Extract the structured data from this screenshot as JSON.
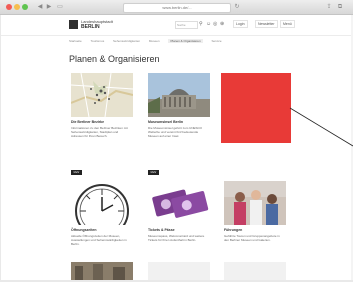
{
  "browser": {
    "address": "www.berlin.de/..."
  },
  "site": {
    "logo_line1": "Landeshauptstadt",
    "logo_line2": "BERLIN",
    "search_placeholder": "Suche",
    "header_links": [
      "Login",
      "Newsletter",
      "Menü"
    ]
  },
  "breadcrumb": [
    "Startseite",
    "Tourismus",
    "Sehenswürdigkeiten",
    "Museen",
    "Planen & Organisieren",
    "Service"
  ],
  "page": {
    "title": "Planen & Organisieren"
  },
  "cards": [
    {
      "title": "Die Berliner Bezirke",
      "text": "Informationen zu den Berliner Bezirken mit Sehenswürdigkeiten, Stadtplan und Adressen für Ihren Besuch.",
      "button": "Mehr"
    },
    {
      "title": "Museumsinsel Berlin",
      "text": "Die Museumsinsel gehört zum UNESCO Welterbe und vereint fünf bedeutende Museen auf einer Insel.",
      "button": "Mehr"
    },
    {
      "title": "Öffnungszeiten",
      "text": "Aktuelle Öffnungszeiten der Museen, Ausstellungen und Sehenswürdigkeiten in Berlin.",
      "button": "Mehr"
    },
    {
      "title": "Tickets & Pässe",
      "text": "Museumspass, WelcomeCard und weitere Tickets für Ihren Aufenthalt in Berlin.",
      "button": "Mehr"
    },
    {
      "title": "Führungen",
      "text": "Geführte Touren und Gruppenangebote in den Berliner Museen und Galerien.",
      "button": "Mehr"
    }
  ],
  "colors": {
    "accent_red": "#e83a37",
    "button_dark": "#222222",
    "purple": "#7a3d8f"
  }
}
